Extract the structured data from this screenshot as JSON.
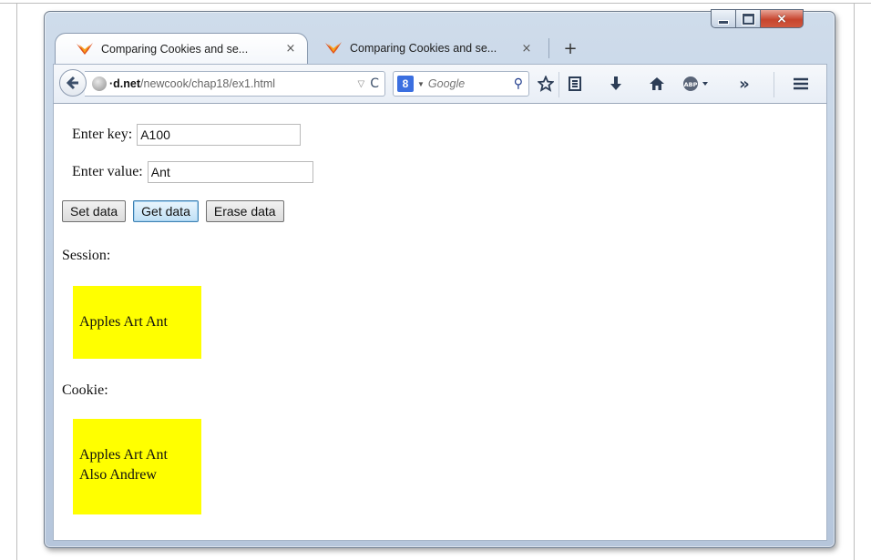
{
  "tabs": [
    {
      "title": "Comparing Cookies and se...",
      "close": "×"
    },
    {
      "title": "Comparing Cookies and se...",
      "close": "×"
    }
  ],
  "new_tab_label": "+",
  "window_controls": {
    "minimize": "minimize",
    "maximize": "maximize",
    "close": "×"
  },
  "navbar": {
    "url_domain": "·d.net",
    "url_path": "/newcook/chap18/ex1.html",
    "url_dropdown": "▽",
    "reload_glyph": "C",
    "search_engine_badge": "8",
    "search_placeholder": "Google",
    "search_glyph": "⚲",
    "overflow_glyph": "»",
    "toolbar_icons": [
      "bookmark-star-icon",
      "reading-list-icon",
      "download-icon",
      "home-icon",
      "adblock-icon",
      "overflow-icon",
      "menu-icon"
    ]
  },
  "form": {
    "key_label": "Enter key:",
    "key_value": "A100",
    "value_label": "Enter value:",
    "value_value": "Ant"
  },
  "buttons": {
    "set": "Set data",
    "get": "Get data",
    "erase": "Erase data"
  },
  "session": {
    "label": "Session:",
    "lines": [
      "Apples Art Ant"
    ]
  },
  "cookie": {
    "label": "Cookie:",
    "lines": [
      "Apples Art Ant",
      "Also Andrew"
    ]
  },
  "colors": {
    "highlight": "#ffff00",
    "close_button": "#c7452e"
  }
}
